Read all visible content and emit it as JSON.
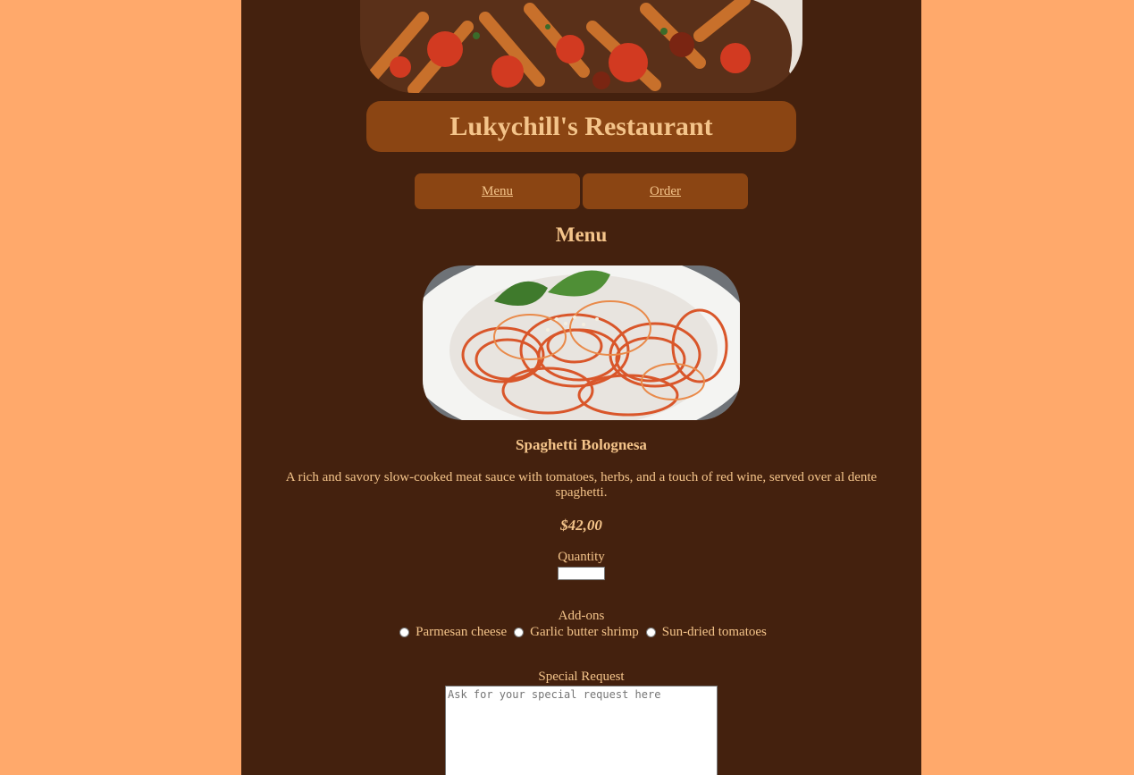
{
  "restaurant": {
    "name": "Lukychill's Restaurant"
  },
  "nav": {
    "items": [
      {
        "label": "Menu"
      },
      {
        "label": "Order"
      }
    ]
  },
  "section": {
    "title": "Menu"
  },
  "dish": {
    "name": "Spaghetti Bolognesa",
    "description": "A rich and savory slow-cooked meat sauce with tomatoes, herbs, and a touch of red wine, served over al dente spaghetti.",
    "price": "$42,00"
  },
  "order_form": {
    "quantity_label": "Quantity",
    "quantity_value": "",
    "addons_label": "Add-ons",
    "addons": [
      {
        "label": "Parmesan cheese",
        "checked": false
      },
      {
        "label": "Garlic butter shrimp",
        "checked": false
      },
      {
        "label": "Sun-dried tomatoes",
        "checked": false
      }
    ],
    "special_request_label": "Special Request",
    "special_request_placeholder": "Ask for your special request here"
  },
  "colors": {
    "page_background": "#ffa96b",
    "content_background": "#44210e",
    "accent_box": "#8b4513",
    "text": "#f4c48a"
  }
}
